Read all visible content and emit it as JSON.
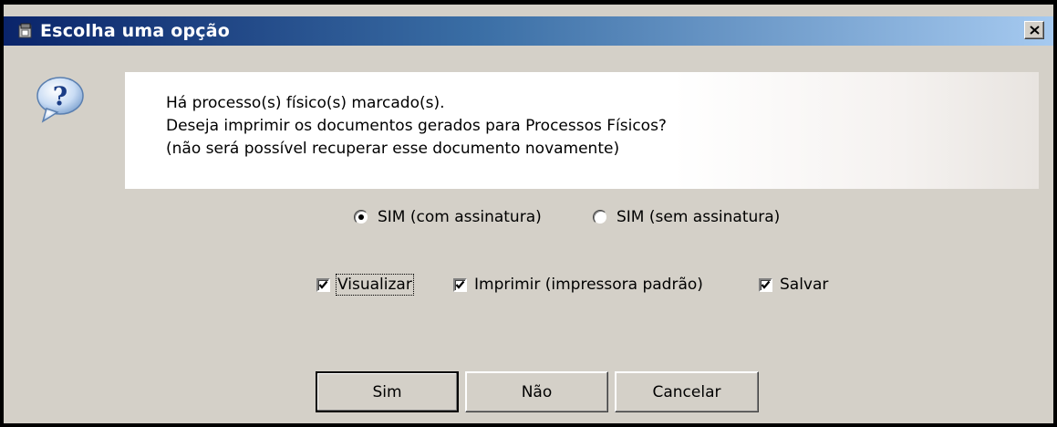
{
  "window": {
    "title": "Escolha uma opção"
  },
  "message": {
    "lines": [
      "Há processo(s) físico(s) marcado(s).",
      "Deseja imprimir os documentos gerados para Processos Físicos?",
      "(não será possível recuperar esse documento novamente)"
    ]
  },
  "signature_options": [
    {
      "label": "SIM (com assinatura)",
      "selected": true
    },
    {
      "label": "SIM (sem assinatura)",
      "selected": false
    }
  ],
  "actions": [
    {
      "label": "Visualizar",
      "checked": true
    },
    {
      "label": "Imprimir (impressora padrão)",
      "checked": true
    },
    {
      "label": "Salvar",
      "checked": true
    }
  ],
  "buttons": {
    "yes": "Sim",
    "no": "Não",
    "cancel": "Cancelar"
  },
  "icons": {
    "title": "app-window-icon",
    "close": "close-icon",
    "help": "question-balloon-icon"
  },
  "colors": {
    "titlebar_start": "#0a246a",
    "titlebar_end": "#a6caf0",
    "dialog_bg": "#d4d0c8"
  }
}
